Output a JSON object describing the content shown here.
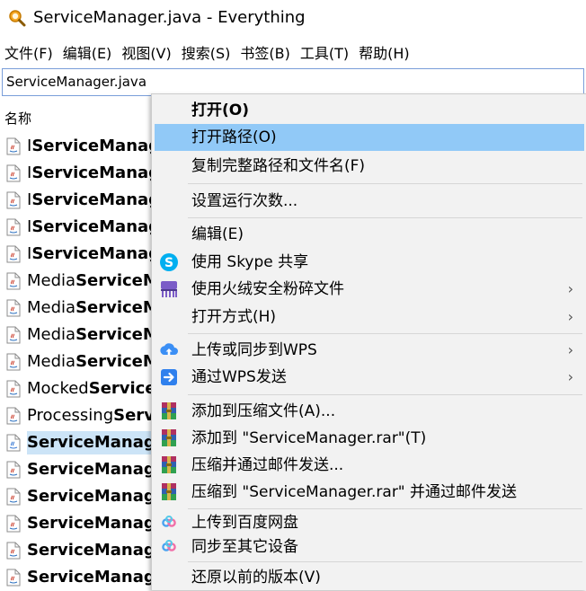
{
  "window": {
    "title": "ServiceManager.java - Everything"
  },
  "menubar": [
    "文件(F)",
    "编辑(E)",
    "视图(V)",
    "搜索(S)",
    "书签(B)",
    "工具(T)",
    "帮助(H)"
  ],
  "search": {
    "value": "ServiceManager.java"
  },
  "columns": {
    "name": "名称"
  },
  "files": [
    {
      "prefix": "I",
      "bold": "ServiceManage",
      "suffix": ""
    },
    {
      "prefix": "I",
      "bold": "ServiceManage",
      "suffix": ""
    },
    {
      "prefix": "I",
      "bold": "ServiceManage",
      "suffix": ""
    },
    {
      "prefix": "I",
      "bold": "ServiceManage",
      "suffix": ""
    },
    {
      "prefix": "I",
      "bold": "ServiceManage",
      "suffix": ""
    },
    {
      "prefix": "Media",
      "bold": "ServiceM",
      "suffix": ""
    },
    {
      "prefix": "Media",
      "bold": "ServiceM",
      "suffix": ""
    },
    {
      "prefix": "Media",
      "bold": "ServiceM",
      "suffix": ""
    },
    {
      "prefix": "Media",
      "bold": "ServiceM",
      "suffix": ""
    },
    {
      "prefix": "Mocked",
      "bold": "ServiceI",
      "suffix": ""
    },
    {
      "prefix": "Processing",
      "bold": "Servi",
      "suffix": ""
    },
    {
      "prefix": "",
      "bold": "ServiceManage",
      "suffix": "",
      "selected": true
    },
    {
      "prefix": "",
      "bold": "ServiceManage",
      "suffix": ""
    },
    {
      "prefix": "",
      "bold": "ServiceManage",
      "suffix": ""
    },
    {
      "prefix": "",
      "bold": "ServiceManage",
      "suffix": ""
    },
    {
      "prefix": "",
      "bold": "ServiceManage",
      "suffix": ""
    },
    {
      "prefix": "",
      "bold": "ServiceManage",
      "suffix": ""
    }
  ],
  "context_menu": {
    "open": "打开(O)",
    "open_path": "打开路径(O)",
    "copy_full_path": "复制完整路径和文件名(F)",
    "set_run_count": "设置运行次数...",
    "edit": "编辑(E)",
    "skype_share": "使用 Skype 共享",
    "shred": "使用火绒安全粉碎文件",
    "open_with": "打开方式(H)",
    "wps_upload": "上传或同步到WPS",
    "wps_send": "通过WPS发送",
    "add_to_archive": "添加到压缩文件(A)...",
    "add_to_rar": "添加到 \"ServiceManager.rar\"(T)",
    "compress_email": "压缩并通过邮件发送...",
    "compress_rar_email": "压缩到 \"ServiceManager.rar\" 并通过邮件发送",
    "baidu_upload": "上传到百度网盘",
    "sync_devices": "同步至其它设备",
    "restore_versions": "还原以前的版本(V)"
  },
  "colors": {
    "hover": "#91c9f7",
    "menu_bg": "#f2f2f2",
    "accent": "#0078d7"
  },
  "icons": [
    "everything-app-icon",
    "java-file-icon",
    "skype-icon",
    "huorong-shred-icon",
    "wps-upload-icon",
    "wps-send-icon",
    "winrar-icon",
    "baidu-netdisk-icon",
    "chevron-right-icon"
  ]
}
